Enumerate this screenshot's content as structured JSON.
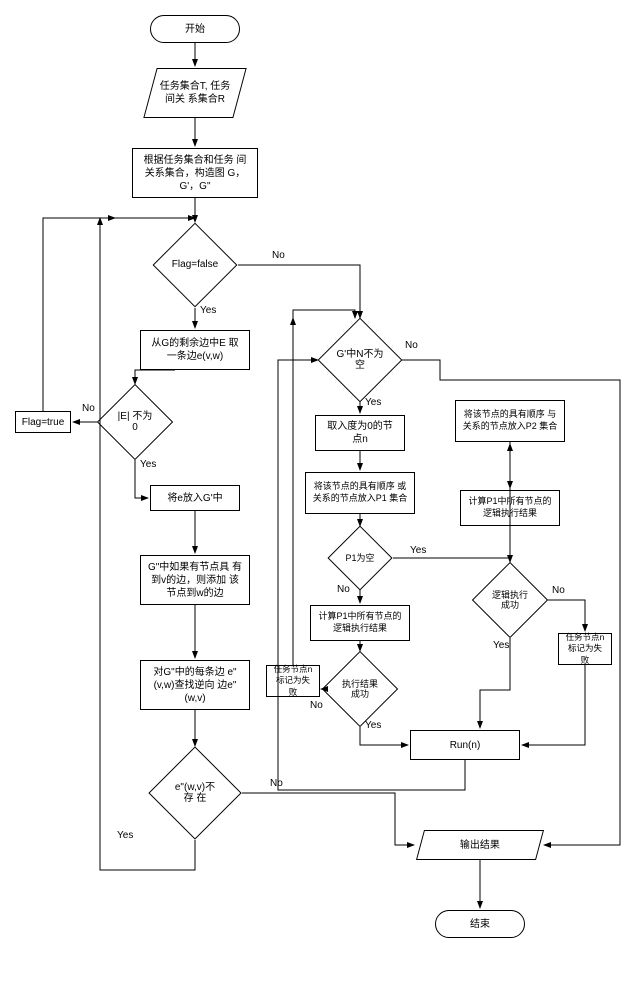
{
  "chart_data": {
    "type": "flowchart",
    "title": "",
    "nodes": [
      {
        "id": "start",
        "type": "terminator",
        "label": "开始"
      },
      {
        "id": "input",
        "type": "io",
        "label": "任务集合T,\n任务间关\n系集合R"
      },
      {
        "id": "construct",
        "type": "process",
        "label": "根据任务集合和任务\n间关系集合，构造图\nG，G'，G\""
      },
      {
        "id": "flagCheck",
        "type": "decision",
        "label": "Flag=false"
      },
      {
        "id": "takeEdge",
        "type": "process",
        "label": "从G的剩余边中E\n取一条边e(v,w)"
      },
      {
        "id": "eNotZero",
        "type": "decision",
        "label": "|E| 不为0"
      },
      {
        "id": "flagTrue",
        "type": "process",
        "label": "Flag=true"
      },
      {
        "id": "putE",
        "type": "process",
        "label": "将e放入G'中"
      },
      {
        "id": "gDouble",
        "type": "process",
        "label": "G\"中如果有节点具\n有到v的边，则添加\n该节点到w的边"
      },
      {
        "id": "forEachEdge",
        "type": "process",
        "label": "对G\"中的每条边\ne\"(v,w)查找逆向\n边e\"(w,v)"
      },
      {
        "id": "wvNotExist",
        "type": "decision",
        "label": "e\"(w,v)不存\n在"
      },
      {
        "id": "gpNnotEmpty",
        "type": "decision",
        "label": "G'中N不为空"
      },
      {
        "id": "takeNode",
        "type": "process",
        "label": "取入度为0的节\n点n"
      },
      {
        "id": "seqOrRel",
        "type": "process",
        "label": "将该节点的具有顺序\n或关系的节点放入P1\n集合"
      },
      {
        "id": "p1Empty",
        "type": "decision",
        "label": "P1为空"
      },
      {
        "id": "calcP1All",
        "type": "process",
        "label": "计算P1中所有节点的\n逻辑执行结果"
      },
      {
        "id": "execResultOk",
        "type": "decision",
        "label": "执行结果成功"
      },
      {
        "id": "taskFail1",
        "type": "process",
        "label": "任务节点n\n标记为失败"
      },
      {
        "id": "putP2",
        "type": "process",
        "label": "将该节点的具有顺序\n与关系的节点放入P2\n集合"
      },
      {
        "id": "calcP1All2",
        "type": "process",
        "label": "计算P1中所有节点的\n逻辑执行结果"
      },
      {
        "id": "logicOk",
        "type": "decision",
        "label": "逻辑执行成功"
      },
      {
        "id": "taskFail2",
        "type": "process",
        "label": "任务节点n\n标记为失败"
      },
      {
        "id": "run",
        "type": "process",
        "label": "Run(n)"
      },
      {
        "id": "output",
        "type": "io",
        "label": "输出结果"
      },
      {
        "id": "end",
        "type": "terminator",
        "label": "结束"
      }
    ],
    "edges": [
      {
        "from": "start",
        "to": "input"
      },
      {
        "from": "input",
        "to": "construct"
      },
      {
        "from": "construct",
        "to": "flagCheck"
      },
      {
        "from": "flagCheck",
        "to": "takeEdge",
        "label": "Yes"
      },
      {
        "from": "flagCheck",
        "to": "gpNnotEmpty",
        "label": "No"
      },
      {
        "from": "takeEdge",
        "to": "eNotZero"
      },
      {
        "from": "eNotZero",
        "to": "flagTrue",
        "label": "No"
      },
      {
        "from": "flagTrue",
        "to": "flagCheck"
      },
      {
        "from": "eNotZero",
        "to": "putE",
        "label": "Yes"
      },
      {
        "from": "putE",
        "to": "gDouble"
      },
      {
        "from": "gDouble",
        "to": "forEachEdge"
      },
      {
        "from": "forEachEdge",
        "to": "wvNotExist"
      },
      {
        "from": "wvNotExist",
        "to": "flagCheck",
        "label": "Yes"
      },
      {
        "from": "wvNotExist",
        "to": "output",
        "label": "No"
      },
      {
        "from": "gpNnotEmpty",
        "to": "takeNode",
        "label": "Yes"
      },
      {
        "from": "gpNnotEmpty",
        "to": "output",
        "label": "No"
      },
      {
        "from": "takeNode",
        "to": "seqOrRel"
      },
      {
        "from": "seqOrRel",
        "to": "p1Empty"
      },
      {
        "from": "p1Empty",
        "to": "calcP1All",
        "label": "No"
      },
      {
        "from": "p1Empty",
        "to": "putP2",
        "label": "Yes"
      },
      {
        "from": "calcP1All",
        "to": "execResultOk"
      },
      {
        "from": "execResultOk",
        "to": "run",
        "label": "Yes"
      },
      {
        "from": "execResultOk",
        "to": "taskFail1",
        "label": "No"
      },
      {
        "from": "taskFail1",
        "to": "gpNnotEmpty"
      },
      {
        "from": "putP2",
        "to": "calcP1All2"
      },
      {
        "from": "calcP1All2",
        "to": "logicOk"
      },
      {
        "from": "logicOk",
        "to": "run",
        "label": "Yes"
      },
      {
        "from": "logicOk",
        "to": "taskFail2",
        "label": "No"
      },
      {
        "from": "taskFail2",
        "to": "run"
      },
      {
        "from": "run",
        "to": "gpNnotEmpty"
      },
      {
        "from": "output",
        "to": "end"
      }
    ],
    "edge_labels": {
      "yes": "Yes",
      "no": "No"
    }
  }
}
